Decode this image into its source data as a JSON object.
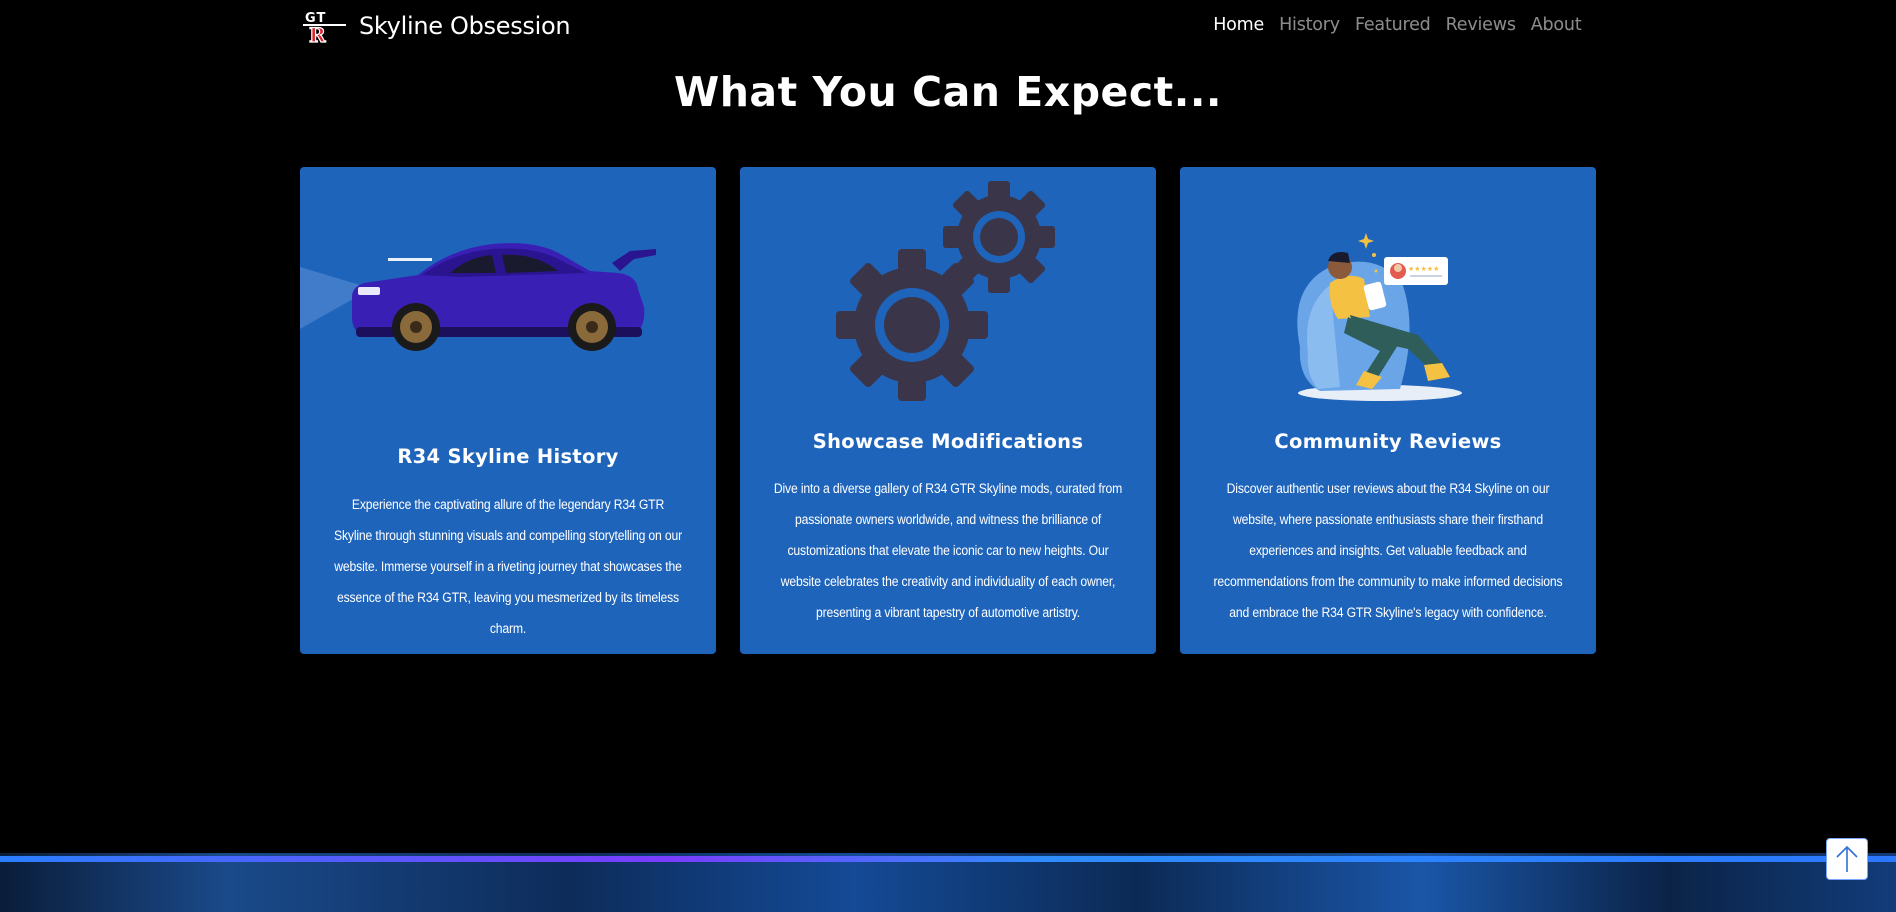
{
  "navbar": {
    "brand_logo_text": "GT R",
    "brand_name": "Skyline Obsession",
    "links": [
      {
        "label": "Home",
        "active": true
      },
      {
        "label": "History",
        "active": false
      },
      {
        "label": "Featured",
        "active": false
      },
      {
        "label": "Reviews",
        "active": false
      },
      {
        "label": "About",
        "active": false
      }
    ]
  },
  "section": {
    "title": "What You Can Expect..."
  },
  "cards": [
    {
      "title": "R34 Skyline History",
      "text": "Experience the captivating allure of the legendary R34 GTR Skyline through stunning visuals and compelling storytelling on our website. Immerse yourself in a riveting journey that showcases the essence of the R34 GTR, leaving you mesmerized by its timeless charm.",
      "image": "car-icon"
    },
    {
      "title": "Showcase Modifications",
      "text": "Dive into a diverse gallery of R34 GTR Skyline mods, curated from passionate owners worldwide, and witness the brilliance of customizations that elevate the iconic car to new heights. Our website celebrates the creativity and individuality of each owner, presenting a vibrant tapestry of automotive artistry.",
      "image": "gears-icon"
    },
    {
      "title": "Community Reviews",
      "text": "Discover authentic user reviews about the R34 Skyline on our website, where passionate enthusiasts share their firsthand experiences and insights. Get valuable feedback and recommendations from the community to make informed decisions and embrace the R34 GTR Skyline's legacy with confidence.",
      "image": "reviewer-illustration"
    }
  ],
  "back_to_top": {
    "icon": "arrow-up-icon"
  },
  "colors": {
    "card_bg": "#1f64bb",
    "page_bg": "#000000",
    "logo_red": "#e0202a",
    "car_purple": "#3a1fb5",
    "gear_dark": "#3a3548"
  }
}
